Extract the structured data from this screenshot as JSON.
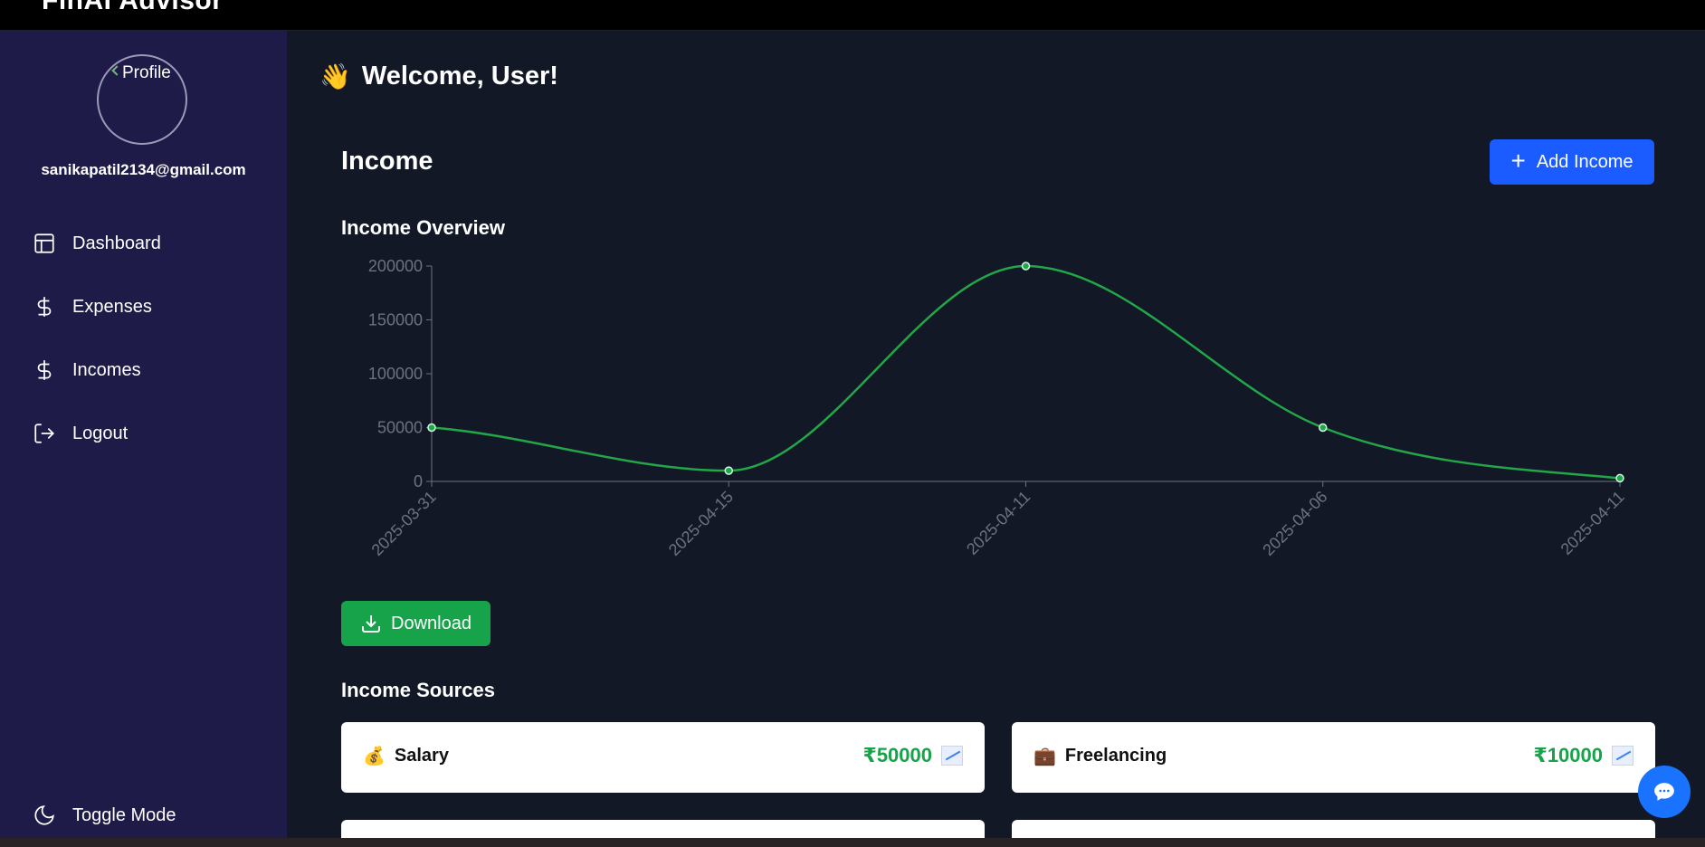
{
  "app": {
    "brand": "FinAI Advisor"
  },
  "sidebar": {
    "avatar_alt": "Profile",
    "email": "sanikapatil2134@gmail.com",
    "items": [
      {
        "label": "Dashboard",
        "icon": "layout-icon"
      },
      {
        "label": "Expenses",
        "icon": "dollar-icon"
      },
      {
        "label": "Incomes",
        "icon": "dollar-icon"
      },
      {
        "label": "Logout",
        "icon": "logout-icon"
      }
    ],
    "toggle_label": "Toggle Mode"
  },
  "main": {
    "welcome": "Welcome, User!",
    "welcome_emoji": "👋",
    "page_title": "Income",
    "add_button": "Add Income",
    "overview_title": "Income Overview",
    "download_button": "Download",
    "sources_title": "Income Sources",
    "sources": [
      {
        "emoji": "💰",
        "category": "Salary",
        "amount": "₹50000"
      },
      {
        "emoji": "💼",
        "category": "Freelancing",
        "amount": "₹10000"
      }
    ]
  },
  "colors": {
    "sidebar_bg": "#1e1b48",
    "main_bg": "#121826",
    "primary_button": "#1a5cff",
    "download_button": "#16a34a",
    "line": "#22a648",
    "amount_green": "#16a34a"
  },
  "chart_data": {
    "type": "line",
    "title": "Income Overview",
    "x": [
      "2025-03-31",
      "2025-04-15",
      "2025-04-11",
      "2025-04-06",
      "2025-04-11"
    ],
    "values": [
      50000,
      10000,
      200000,
      50000,
      3000
    ],
    "yticks": [
      0,
      50000,
      100000,
      150000,
      200000
    ],
    "ylim": [
      0,
      200000
    ],
    "grid": false,
    "smooth": true
  }
}
